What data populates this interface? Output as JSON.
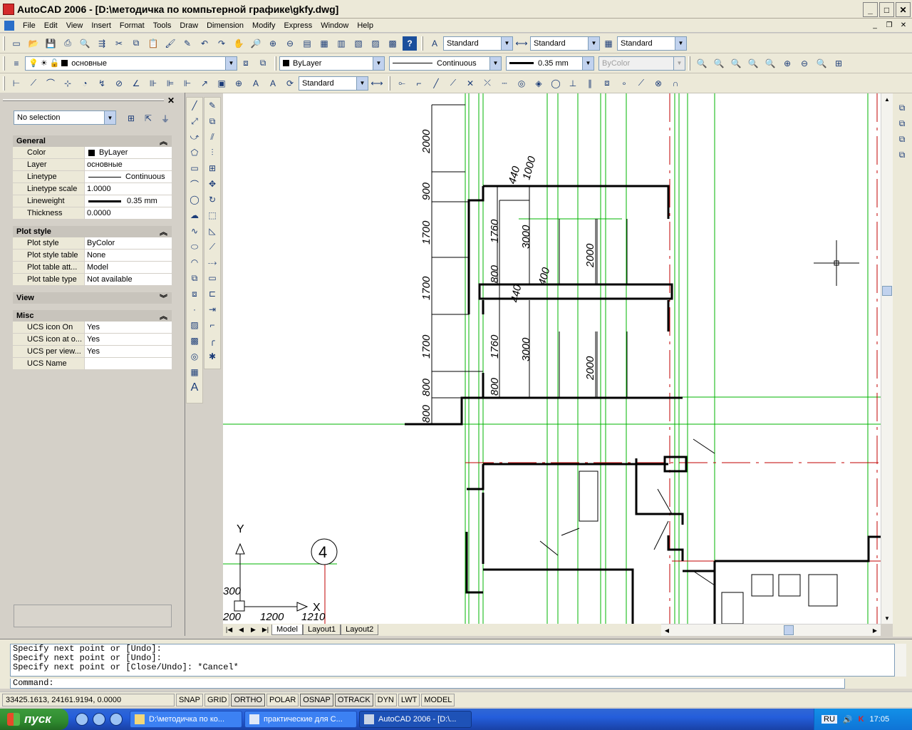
{
  "window": {
    "title": "AutoCAD 2006 - [D:\\методичка по компьтерной графике\\gkfy.dwg]",
    "min": "_",
    "max": "□",
    "close": "✕"
  },
  "menu": [
    "File",
    "Edit",
    "View",
    "Insert",
    "Format",
    "Tools",
    "Draw",
    "Dimension",
    "Modify",
    "Express",
    "Window",
    "Help"
  ],
  "styles_toolbar": {
    "text_style": "Standard",
    "dim_style": "Standard",
    "table_style": "Standard"
  },
  "layers_toolbar": {
    "layer": "основные"
  },
  "properties_toolbar": {
    "color": "ByLayer",
    "linetype": "Continuous",
    "lineweight": "0.35 mm",
    "plotstyle": "ByColor"
  },
  "dim_toolbar": {
    "dim_style": "Standard"
  },
  "properties_palette": {
    "selection": "No selection",
    "sections": {
      "general": {
        "title": "General",
        "rows": [
          {
            "k": "Color",
            "v": "ByLayer"
          },
          {
            "k": "Layer",
            "v": "основные"
          },
          {
            "k": "Linetype",
            "v": "Continuous"
          },
          {
            "k": "Linetype scale",
            "v": "1.0000"
          },
          {
            "k": "Lineweight",
            "v": "0.35 mm"
          },
          {
            "k": "Thickness",
            "v": "0.0000"
          }
        ]
      },
      "plot": {
        "title": "Plot style",
        "rows": [
          {
            "k": "Plot style",
            "v": "ByColor"
          },
          {
            "k": "Plot style table",
            "v": "None"
          },
          {
            "k": "Plot table att...",
            "v": "Model"
          },
          {
            "k": "Plot table type",
            "v": "Not available"
          }
        ]
      },
      "view": {
        "title": "View"
      },
      "misc": {
        "title": "Misc",
        "rows": [
          {
            "k": "UCS icon On",
            "v": "Yes"
          },
          {
            "k": "UCS icon at o...",
            "v": "Yes"
          },
          {
            "k": "UCS per view...",
            "v": "Yes"
          },
          {
            "k": "UCS Name",
            "v": ""
          }
        ]
      }
    }
  },
  "drawing": {
    "dims": [
      "2000",
      "900",
      "1700",
      "1700",
      "1700",
      "800",
      "800",
      "440",
      "1000",
      "1760",
      "800",
      "440",
      "1760",
      "800",
      "3000",
      "400",
      "3000",
      "2000",
      "2000",
      "1200",
      "1210",
      "300",
      "200"
    ],
    "axis_label": "4",
    "ucs_y": "Y",
    "ucs_x": "X"
  },
  "tabs": [
    "Model",
    "Layout1",
    "Layout2"
  ],
  "command": {
    "history": [
      "Specify next point or [Undo]:",
      "Specify next point or [Undo]:",
      "Specify next point or [Close/Undo]: *Cancel*"
    ],
    "prompt": "Command:"
  },
  "status": {
    "coords": "33425.1613, 24161.9194, 0.0000",
    "toggles": [
      "SNAP",
      "GRID",
      "ORTHO",
      "POLAR",
      "OSNAP",
      "OTRACK",
      "DYN",
      "LWT",
      "MODEL"
    ]
  },
  "taskbar": {
    "start": "пуск",
    "tasks": [
      "D:\\методичка по ко...",
      "практические для С...",
      "AutoCAD 2006 - [D:\\..."
    ],
    "lang": "RU",
    "clock": "17:05"
  },
  "colors": {
    "accent": "#245edb",
    "grid_green": "#00b000",
    "axis_red": "#c00000"
  }
}
